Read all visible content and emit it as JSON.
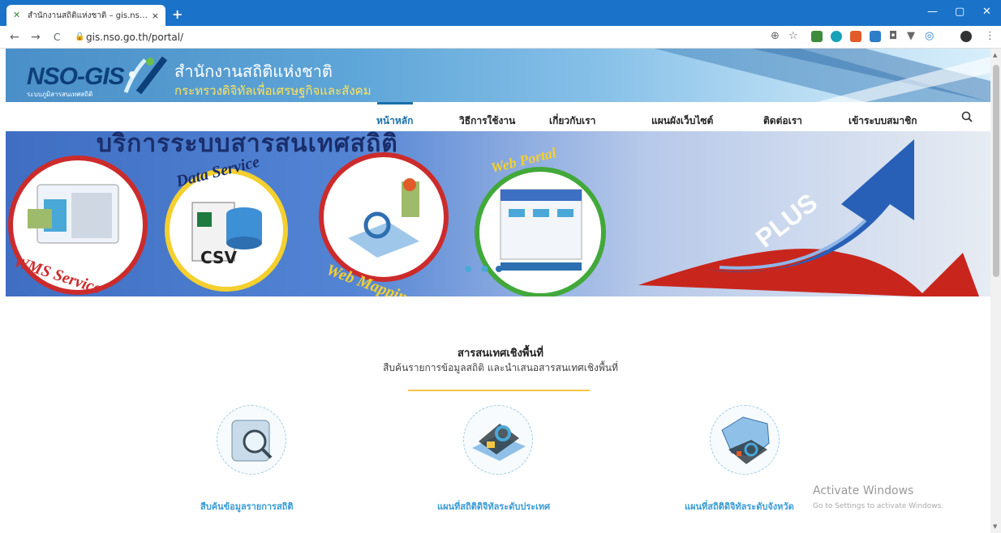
{
  "browser": {
    "tab_title": "สำนักงานสถิติแห่งชาติ – gis.nso : ภูมิ",
    "tab_close": "×",
    "new_tab": "+",
    "url": "gis.nso.go.th/portal/",
    "back": "←",
    "forward": "→",
    "reload": "C",
    "minimize": "—",
    "maximize": "▢",
    "close": "✕",
    "menu": "⋮"
  },
  "header": {
    "logo_text": "NSO-GIS",
    "logo_sub": "ระบบภูมิสารสนเทศสถิติ",
    "org_name": "สำนักงานสถิติแห่งชาติ",
    "ministry": "กระทรวงดิจิทัลเพื่อเศรษฐกิจและสังคม"
  },
  "nav": {
    "items": [
      {
        "label": "หน้าหลัก",
        "active": true
      },
      {
        "label": "วิธีการใช้งาน",
        "active": false
      },
      {
        "label": "เกี่ยวกับเรา",
        "active": false
      },
      {
        "label": "แผนผังเว็บไซต์",
        "active": false
      },
      {
        "label": "ติดต่อเรา",
        "active": false
      },
      {
        "label": "เข้าระบบสมาชิก",
        "active": false
      }
    ],
    "search_icon": "search-icon"
  },
  "hero": {
    "title": "บริการระบบสารสนเทศสถิติ",
    "services": [
      "WMS Service",
      "Data Service",
      "Web Mapping",
      "Web Portal"
    ],
    "csv_label": "CSV",
    "plus_label": "PLUS"
  },
  "section": {
    "title": "สารสนเทศเชิงพื้นที่",
    "subtitle": "สืบค้นรายการข้อมูลสถิติ และนำเสนอสารสนเทศเชิงพื้นที่"
  },
  "cards": [
    {
      "label": "สืบค้นข้อมูลรายการสถิติ",
      "icon": "search-database-icon"
    },
    {
      "label": "แผนที่สถิติดิจิทัลระดับประเทศ",
      "icon": "map-phone-icon"
    },
    {
      "label": "แผนที่สถิติดิจิทัลระดับจังหวัด",
      "icon": "province-map-icon"
    }
  ],
  "watermark": {
    "line1": "Activate Windows",
    "line2": "Go to Settings to activate Windows."
  },
  "colors": {
    "chrome_blue": "#1a73c8",
    "nav_active": "#1a6fa8",
    "card_label": "#3a9bd5",
    "accent_line": "#f4c542"
  }
}
